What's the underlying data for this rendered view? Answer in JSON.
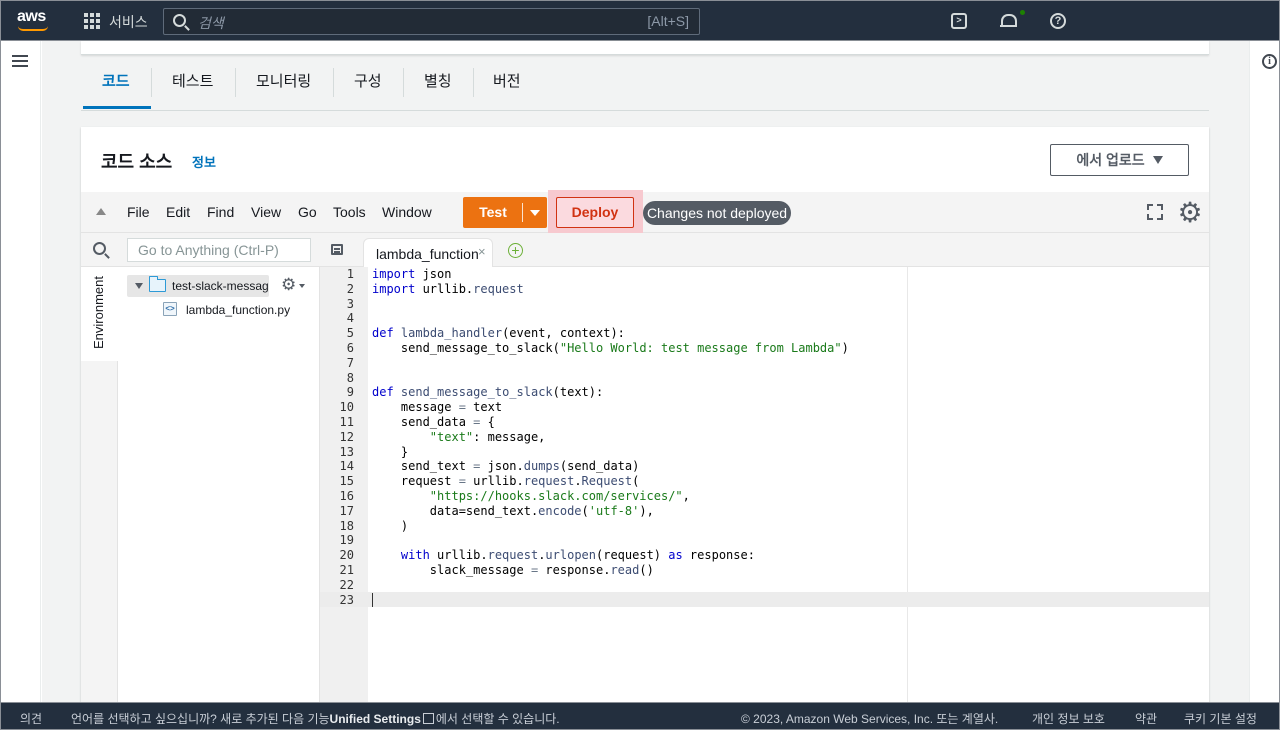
{
  "topnav": {
    "logo": "aws",
    "services_label": "서비스",
    "search_placeholder": "검색",
    "search_shortcut": "[Alt+S]",
    "icons": [
      "cloudshell-icon",
      "bell-icon",
      "help-icon"
    ]
  },
  "tabs": [
    {
      "label": "코드",
      "active": true
    },
    {
      "label": "테스트"
    },
    {
      "label": "모니터링"
    },
    {
      "label": "구성"
    },
    {
      "label": "별칭"
    },
    {
      "label": "버전"
    }
  ],
  "panel": {
    "title": "코드 소스",
    "info_link": "정보",
    "upload_label": "에서 업로드"
  },
  "ide": {
    "menu": [
      "File",
      "Edit",
      "Find",
      "View",
      "Go",
      "Tools",
      "Window"
    ],
    "test_label": "Test",
    "deploy_label": "Deploy",
    "status_badge": "Changes not deployed",
    "goto_placeholder": "Go to Anything (Ctrl-P)",
    "environment_label": "Environment",
    "folder_name": "test-slack-messages",
    "file_name": "lambda_function.py",
    "open_tab": "lambda_function",
    "tab_close": "×",
    "colors": {
      "test": "#ec7211",
      "deploy_text": "#d13212",
      "badge": "#545b64"
    }
  },
  "code_lines": [
    "import json",
    "import urllib.request",
    "",
    "",
    "def lambda_handler(event, context):",
    "    send_message_to_slack(\"Hello World: test message from Lambda\")",
    "",
    "",
    "def send_message_to_slack(text):",
    "    message = text",
    "    send_data = {",
    "        \"text\": message,",
    "    }",
    "    send_text = json.dumps(send_data)",
    "    request = urllib.request.Request(",
    "        \"https://hooks.slack.com/services/\",",
    "        data=send_text.encode('utf-8'),",
    "    )",
    "",
    "    with urllib.request.urlopen(request) as response:",
    "        slack_message = response.read()",
    "",
    ""
  ],
  "footer": {
    "feedback": "의견",
    "language_prefix": "언어를 선택하고 싶으십니까? 새로 추가된 다음 기능",
    "unified_settings": "Unified Settings",
    "language_suffix": "에서 선택할 수 있습니다.",
    "copyright": "© 2023, Amazon Web Services, Inc. 또는 계열사.",
    "privacy": "개인 정보 보호",
    "terms": "약관",
    "cookies": "쿠키 기본 설정"
  }
}
